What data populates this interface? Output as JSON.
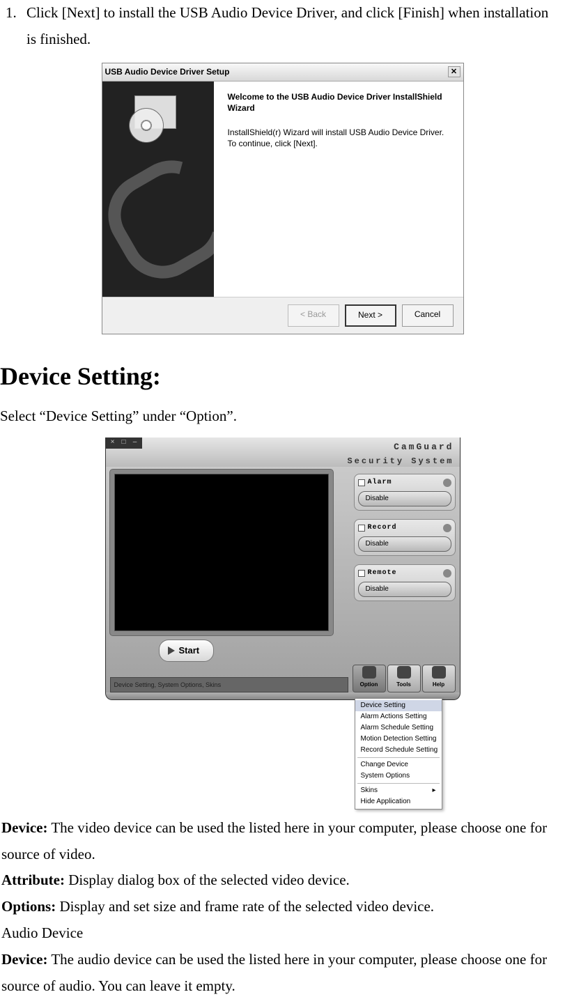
{
  "step": {
    "num": "1.",
    "text": "Click [Next] to install the USB Audio Device Driver, and click [Finish] when installation is finished."
  },
  "wizard": {
    "title": "USB Audio Device Driver Setup",
    "welcome": "Welcome to the USB Audio Device Driver InstallShield Wizard",
    "desc": "InstallShield(r) Wizard will install USB Audio Device Driver.  To continue, click [Next].",
    "back": "< Back",
    "next": "Next >",
    "cancel": "Cancel"
  },
  "heading": "Device Setting:",
  "instruction": "Select “Device Setting” under “Option”.",
  "camguard": {
    "brand": "CamGuard",
    "subtitle": "Security System",
    "start_label": "Start",
    "modules": [
      {
        "title": "Alarm",
        "status": "Disable"
      },
      {
        "title": "Record",
        "status": "Disable"
      },
      {
        "title": "Remote",
        "status": "Disable"
      }
    ],
    "toolbar": {
      "option": "Option",
      "tools": "Tools",
      "help": "Help"
    },
    "status_bar": "Device Setting, System Options, Skins",
    "btn_close": "×",
    "btn_max": "□",
    "btn_min": "–"
  },
  "menu_items": {
    "device_setting": "Device Setting",
    "alarm_actions": "Alarm Actions Setting",
    "alarm_schedule": "Alarm Schedule Setting",
    "motion": "Motion Detection Setting",
    "record_sched": "Record Schedule Setting",
    "change_device": "Change Device",
    "system_options": "System Options",
    "skins": "Skins",
    "hide_app": "Hide Application"
  },
  "defs": {
    "device_label": "Device:",
    "device_text": "  The video device can be used the listed here in your computer, please choose one for source of video.",
    "attribute_label": "Attribute:",
    "attribute_text": " Display dialog box of the selected video device.",
    "options_label": "Options:",
    "options_text": " Display and set size and frame rate of the selected video device.",
    "audio_device": "Audio Device",
    "device2_label": "Device:",
    "device2_text": "  The audio device can be used the listed here in your computer, please choose one for source of audio. You can leave it empty."
  }
}
